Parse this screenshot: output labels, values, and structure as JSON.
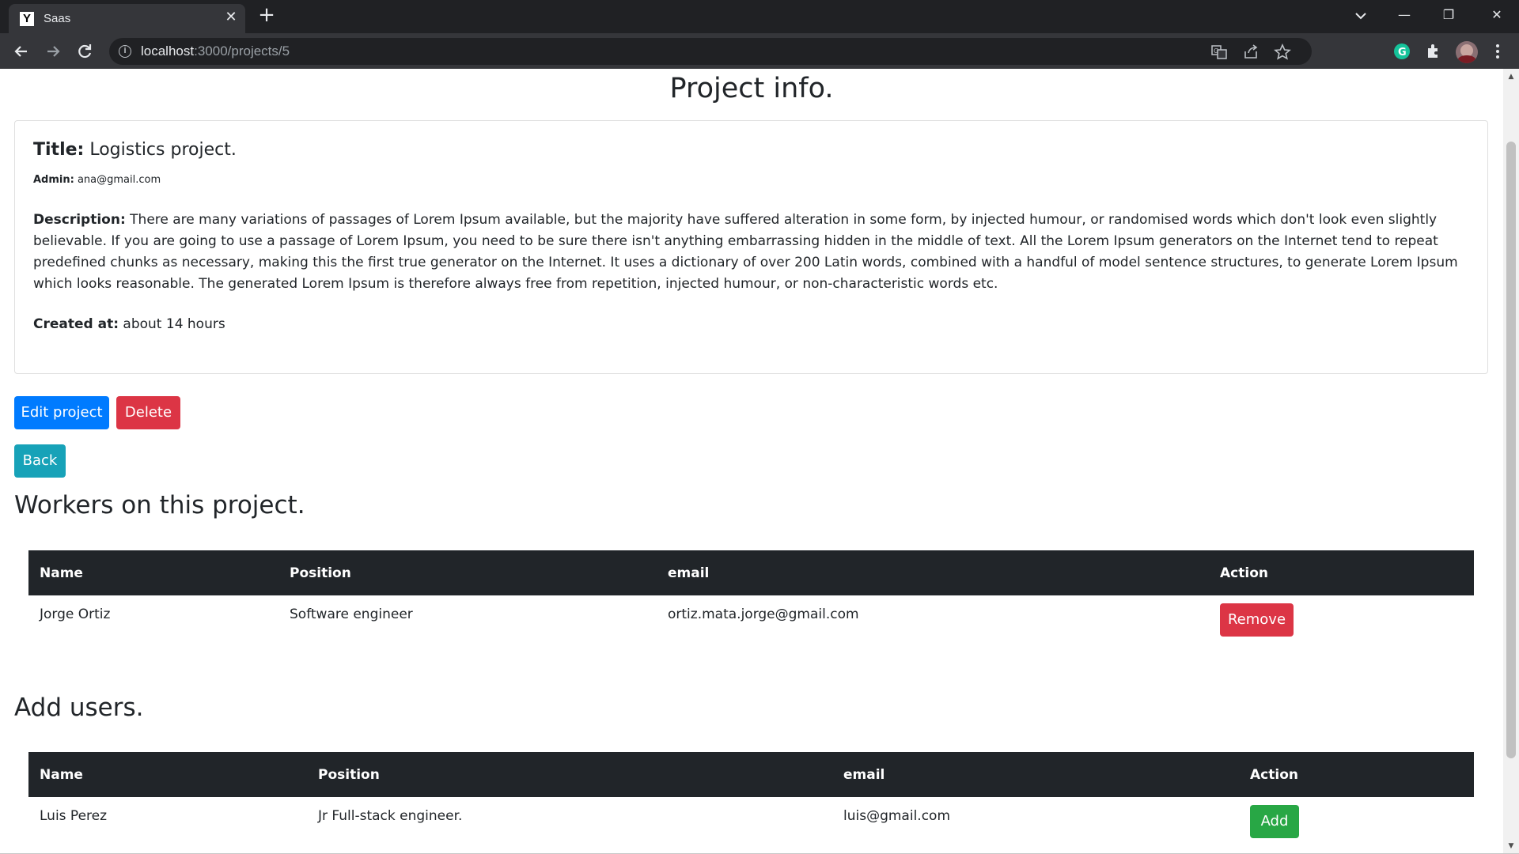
{
  "browser": {
    "tab_title": "Saas",
    "favicon_letter": "Y",
    "url_host": "localhost",
    "url_path": ":3000/projects/5"
  },
  "page": {
    "title": "Project info."
  },
  "project": {
    "title_label": "Title:",
    "title_value": "Logistics project.",
    "admin_label": "Admin:",
    "admin_value": "ana@gmail.com",
    "description_label": "Description:",
    "description_value": "There are many variations of passages of Lorem Ipsum available, but the majority have suffered alteration in some form, by injected humour, or randomised words which don't look even slightly believable. If you are going to use a passage of Lorem Ipsum, you need to be sure there isn't anything embarrassing hidden in the middle of text. All the Lorem Ipsum generators on the Internet tend to repeat predefined chunks as necessary, making this the first true generator on the Internet. It uses a dictionary of over 200 Latin words, combined with a handful of model sentence structures, to generate Lorem Ipsum which looks reasonable. The generated Lorem Ipsum is therefore always free from repetition, injected humour, or non-characteristic words etc.",
    "created_label": "Created at:",
    "created_value": "about 14 hours"
  },
  "actions": {
    "edit_label": "Edit project",
    "delete_label": "Delete",
    "back_label": "Back"
  },
  "workers": {
    "heading": "Workers on this project.",
    "columns": [
      "Name",
      "Position",
      "email",
      "Action"
    ],
    "rows": [
      {
        "name": "Jorge Ortiz",
        "position": "Software engineer",
        "email": "ortiz.mata.jorge@gmail.com",
        "action": "Remove"
      }
    ]
  },
  "add_users": {
    "heading": "Add users.",
    "columns": [
      "Name",
      "Position",
      "email",
      "Action"
    ],
    "rows": [
      {
        "name": "Luis Perez",
        "position": "Jr Full-stack engineer.",
        "email": "luis@gmail.com",
        "action": "Add"
      }
    ]
  },
  "colors": {
    "primary": "#007bff",
    "danger": "#dc3545",
    "info": "#17a2b8",
    "success": "#28a745",
    "table_header": "#212529"
  }
}
